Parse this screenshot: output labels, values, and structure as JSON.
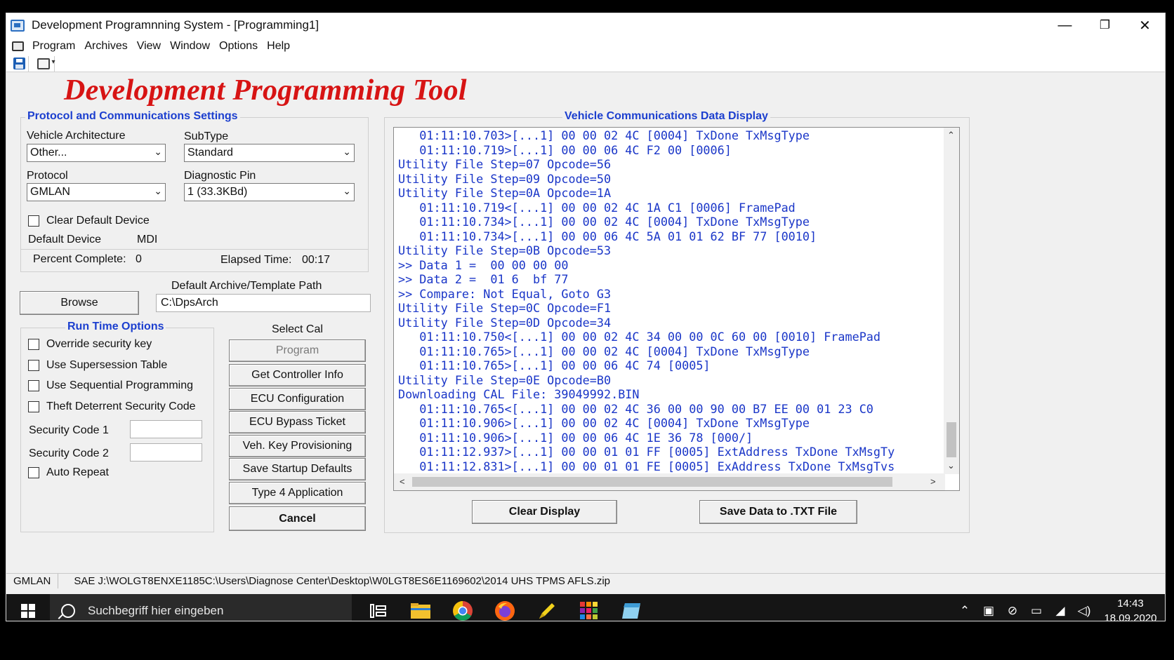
{
  "window": {
    "title": "Development Programnning System - [Programming1]",
    "minimize": "—",
    "restore": "❐",
    "close": "✕"
  },
  "menu": [
    "Program",
    "Archives",
    "View",
    "Window",
    "Options",
    "Help"
  ],
  "header": "Development Programming Tool",
  "protocol_settings": {
    "title": "Protocol and Communications Settings",
    "vehicle_architecture_label": "Vehicle Architecture",
    "vehicle_architecture_value": "Other...",
    "subtype_label": "SubType",
    "subtype_value": "Standard",
    "protocol_label": "Protocol",
    "protocol_value": "GMLAN",
    "diagnostic_pin_label": "Diagnostic Pin",
    "diagnostic_pin_value": "1 (33.3KBd)",
    "clear_default_device_label": "Clear Default Device",
    "default_device_label": "Default Device",
    "default_device_value": "MDI",
    "percent_complete_label": "Percent Complete:",
    "percent_complete_value": "0",
    "elapsed_time_label": "Elapsed Time:",
    "elapsed_time_value": "00:17"
  },
  "archive": {
    "browse_label": "Browse",
    "path_label": "Default Archive/Template Path",
    "path_value": "C:\\DpsArch"
  },
  "run_time_options": {
    "title": "Run Time Options",
    "override_security_key": "Override security key",
    "use_supersession_table": "Use Supersession Table",
    "use_sequential_programming": "Use Sequential Programming",
    "theft_deterrent_security_code": "Theft Deterrent Security Code",
    "security_code_1_label": "Security Code 1",
    "security_code_2_label": "Security Code 2",
    "auto_repeat": "Auto Repeat"
  },
  "select_cal": {
    "title": "Select Cal",
    "program": "Program",
    "get_controller_info": "Get Controller Info",
    "ecu_configuration": "ECU Configuration",
    "ecu_bypass_ticket": "ECU Bypass Ticket",
    "veh_key_provisioning": "Veh. Key Provisioning",
    "save_startup_defaults": "Save Startup Defaults",
    "type4_application": "Type 4 Application",
    "cancel": "Cancel"
  },
  "vehicle_comm": {
    "title": "Vehicle Communications Data Display",
    "lines": [
      "   01:11:10.703>[...1] 00 00 02 4C [0004] TxDone TxMsgType",
      "   01:11:10.719>[...1] 00 00 06 4C F2 00 [0006]",
      "Utility File Step=07 Opcode=56",
      "Utility File Step=09 Opcode=50",
      "Utility File Step=0A Opcode=1A",
      "   01:11:10.719<[...1] 00 00 02 4C 1A C1 [0006] FramePad",
      "   01:11:10.734>[...1] 00 00 02 4C [0004] TxDone TxMsgType",
      "   01:11:10.734>[...1] 00 00 06 4C 5A 01 01 62 BF 77 [0010]",
      "Utility File Step=0B Opcode=53",
      ">> Data 1 =  00 00 00 00",
      ">> Data 2 =  01 6  bf 77",
      ">> Compare: Not Equal, Goto G3",
      "Utility File Step=0C Opcode=F1",
      "Utility File Step=0D Opcode=34",
      "   01:11:10.750<[...1] 00 00 02 4C 34 00 00 0C 60 00 [0010] FramePad",
      "   01:11:10.765>[...1] 00 00 02 4C [0004] TxDone TxMsgType",
      "   01:11:10.765>[...1] 00 00 06 4C 74 [0005]",
      "Utility File Step=0E Opcode=B0",
      "Downloading CAL File: 39049992.BIN",
      "   01:11:10.765<[...1] 00 00 02 4C 36 00 00 90 00 B7 EE 00 01 23 C0",
      "   01:11:10.906>[...1] 00 00 02 4C [0004] TxDone TxMsgType",
      "   01:11:10.906>[...1] 00 00 06 4C 1E 36 78 [000/]",
      "   01:11:12.937>[...1] 00 00 01 01 FF [0005] ExtAddress TxDone TxMsgTy",
      "   01:11:12.831>[...1] 00 00 01 01 FE [0005] ExAddress TxDone TxMsgTvs"
    ],
    "clear_display": "Clear Display",
    "save_data": "Save Data to .TXT File"
  },
  "status_bar": {
    "protocol": "GMLAN",
    "path": "SAE J:\\WOLGT8ENXE1185C:\\Users\\Diagnose Center\\Desktop\\W0LGT8ES6E1169602\\2014 UHS TPMS AFLS.zip"
  },
  "taskbar": {
    "search_placeholder": "Suchbegriff hier eingeben",
    "time": "14:43",
    "date": "18.09.2020"
  }
}
